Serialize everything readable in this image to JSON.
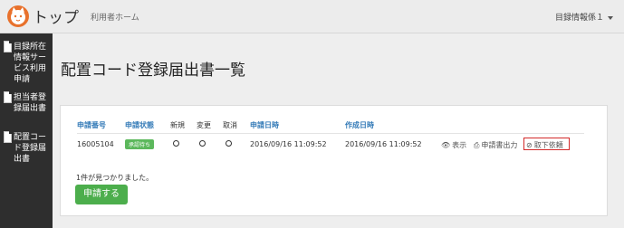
{
  "topbar": {
    "brand": "トップ",
    "home_link": "利用者ホーム",
    "user_menu": "目録情報係１"
  },
  "sidebar": {
    "items": [
      {
        "label": "目録所在情報サービス利用申請",
        "icon": "document-icon"
      },
      {
        "label": "担当者登録届出書",
        "icon": "document-icon"
      },
      {
        "label": "配置コード登録届出書",
        "icon": "document-icon"
      }
    ]
  },
  "page": {
    "title": "配置コード登録届出書一覧"
  },
  "table": {
    "headers": {
      "app_no": "申請番号",
      "status": "申請状態",
      "new": "新規",
      "change": "変更",
      "cancel": "取消",
      "app_date": "申請日時",
      "created_date": "作成日時"
    },
    "rows": [
      {
        "app_no": "16005104",
        "status": "承認待ち",
        "app_date": "2016/09/16 11:09:52",
        "created_date": "2016/09/16 11:09:52",
        "actions": {
          "view": "表示",
          "print": "申請書出力",
          "withdraw": "取下依頼"
        }
      }
    ]
  },
  "result_count": "1件が見つかりました。",
  "apply_button": "申請する",
  "colors": {
    "accent_blue": "#337ab7",
    "success_green": "#4cae4c",
    "highlight_red": "#d32a2a",
    "logo_orange": "#e8712c"
  }
}
